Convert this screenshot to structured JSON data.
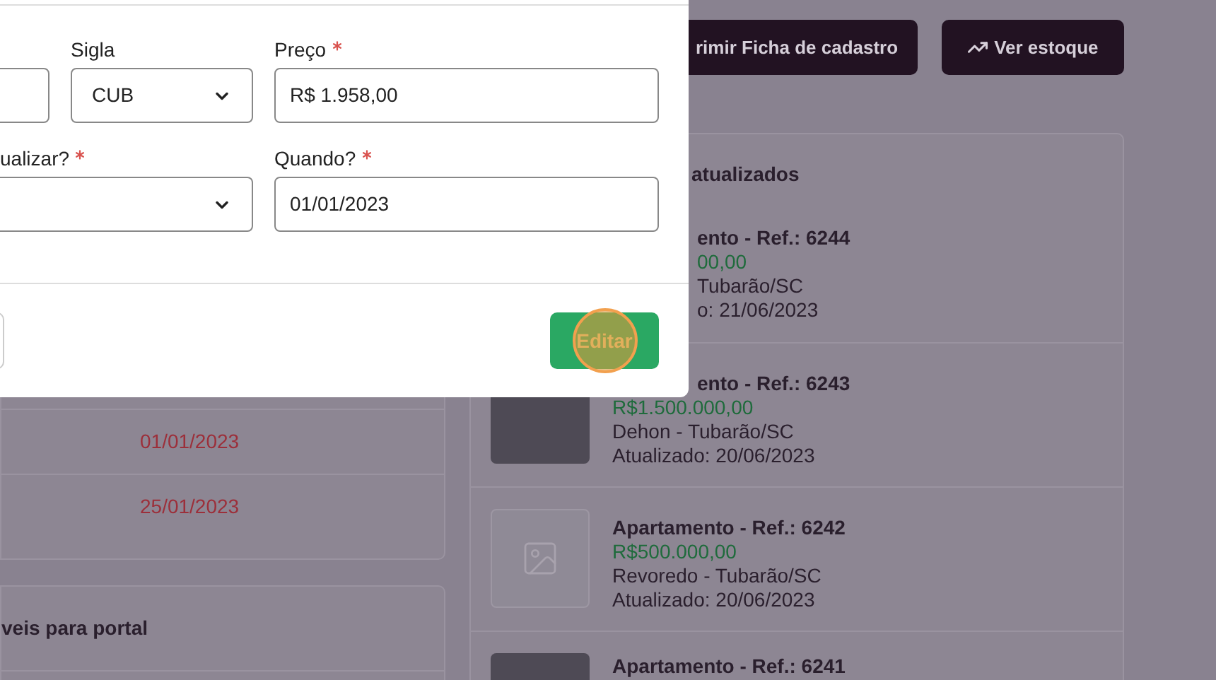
{
  "page": {
    "header_buttons": [
      {
        "label": "rimir Ficha de cadastro"
      },
      {
        "label": "Ver estoque"
      }
    ],
    "dates_card": {
      "rows": [
        "01/01/2023",
        "25/01/2023"
      ]
    },
    "portal_card": {
      "title": "veis para portal"
    },
    "recent_card": {
      "title": "atualizados",
      "items": [
        {
          "kind": "hidden",
          "title": "ento - Ref.: 6244",
          "price": "00,00",
          "location": "Tubarão/SC",
          "updated": "o: 21/06/2023"
        },
        {
          "kind": "photo",
          "title": "ento - Ref.: 6243",
          "price": "R$1.500.000,00",
          "location": "Dehon - Tubarão/SC",
          "updated": "Atualizado: 20/06/2023"
        },
        {
          "kind": "placeholder",
          "title": "Apartamento - Ref.: 6242",
          "price": "R$500.000,00",
          "location": "Revoredo - Tubarão/SC",
          "updated": "Atualizado: 20/06/2023"
        },
        {
          "kind": "photo",
          "title": "Apartamento - Ref.: 6241"
        }
      ]
    }
  },
  "modal": {
    "fields": [
      {
        "kind": "input"
      },
      {
        "kind": "select",
        "label": "Sigla",
        "required": false,
        "value": "CUB"
      },
      {
        "kind": "input",
        "label": "Preço",
        "required": true,
        "value": "R$ 1.958,00"
      },
      {
        "kind": "select",
        "label": "ualizar?",
        "required": true
      },
      {
        "kind": "input",
        "label": "Quando?",
        "required": true,
        "value": "01/01/2023"
      }
    ],
    "buttons": [
      {
        "kind": "outline"
      },
      {
        "kind": "primary",
        "label": "Editar"
      }
    ]
  }
}
